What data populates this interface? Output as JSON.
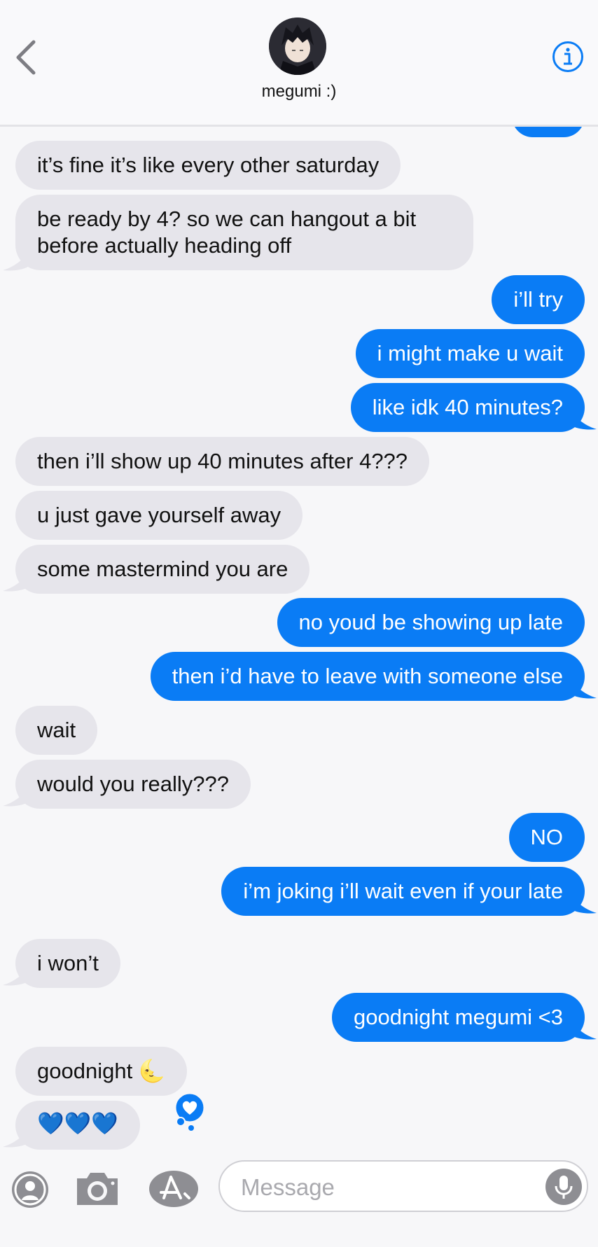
{
  "header": {
    "contact_name": "megumi :)"
  },
  "messages": [
    {
      "side": "out",
      "text": ""
    },
    {
      "side": "in",
      "text": "it’s fine it’s like every other saturday"
    },
    {
      "side": "in",
      "text": "be ready by 4? so we can hangout a bit before actually heading off"
    },
    {
      "side": "out",
      "text": "i’ll try"
    },
    {
      "side": "out",
      "text": "i might make u wait"
    },
    {
      "side": "out",
      "text": "like idk 40 minutes?"
    },
    {
      "side": "in",
      "text": "then i’ll show up 40 minutes after 4???"
    },
    {
      "side": "in",
      "text": "u just gave yourself away"
    },
    {
      "side": "in",
      "text": "some mastermind you are"
    },
    {
      "side": "out",
      "text": "no youd be showing up late"
    },
    {
      "side": "out",
      "text": "then i’d have to leave with someone else"
    },
    {
      "side": "in",
      "text": "wait"
    },
    {
      "side": "in",
      "text": "would you really???"
    },
    {
      "side": "out",
      "text": "NO"
    },
    {
      "side": "out",
      "text": "i’m joking i’ll wait even if your late"
    },
    {
      "side": "in",
      "text": "i won’t"
    },
    {
      "side": "out",
      "text": "goodnight megumi <3"
    },
    {
      "side": "in",
      "text": "goodnight 🌜"
    },
    {
      "side": "in",
      "text": "💙💙💙",
      "tapback": "heart"
    }
  ],
  "composer": {
    "placeholder": "Message"
  },
  "icons": {
    "back": "chevron-left-icon",
    "info": "info-icon",
    "contact": "person-icon",
    "camera": "camera-icon",
    "apps": "app-store-icon",
    "mic": "microphone-icon",
    "tapback": "heart-icon"
  },
  "colors": {
    "outgoing_bubble": "#0a7cf5",
    "incoming_bubble": "#e6e5eb",
    "accent": "#0a7cf5"
  }
}
